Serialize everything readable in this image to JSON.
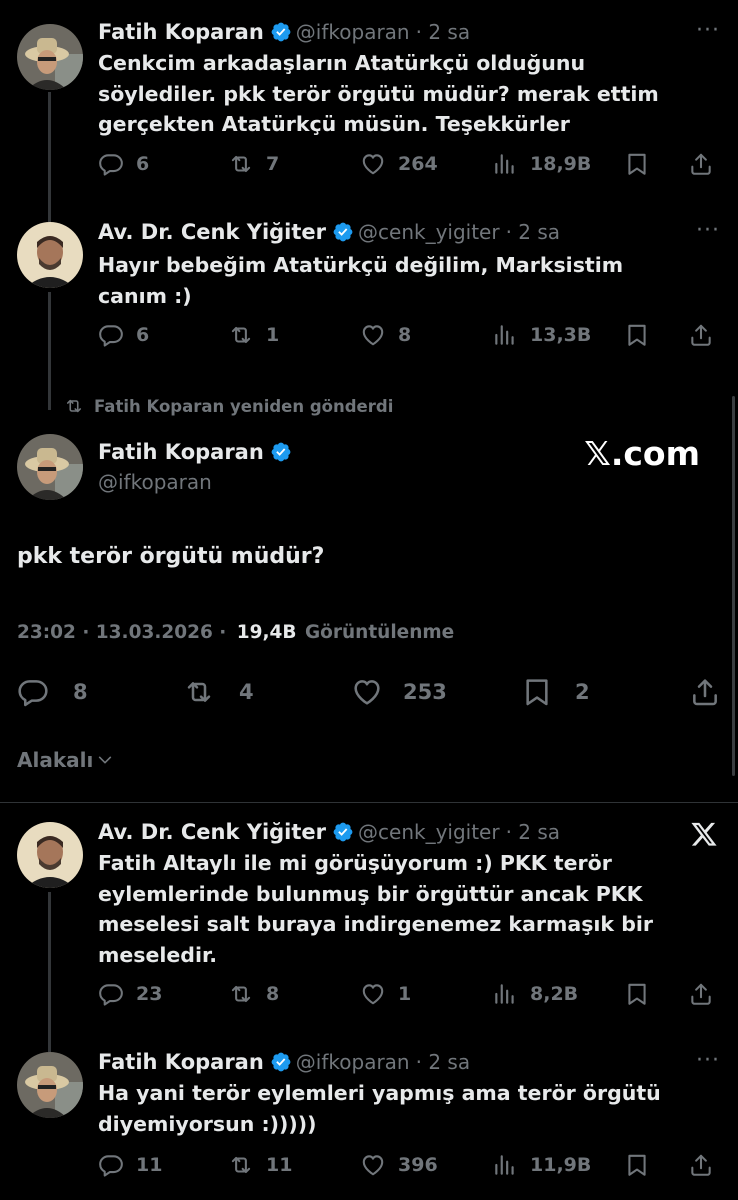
{
  "tweets": [
    {
      "author": "Fatih Koparan",
      "handle": "@ifkoparan",
      "time": "· 2 sa",
      "text_lines": [
        "Cenkcim arkadaşların Atatürkçü olduğunu",
        "söylediler. pkk terör örgütü müdür? merak ettim",
        "gerçekten Atatürkçü müsün. Teşekkürler"
      ],
      "replies": "6",
      "reposts": "7",
      "likes": "264",
      "views": "18,9B"
    },
    {
      "author": "Av. Dr. Cenk Yiğiter",
      "handle": "@cenk_yigiter",
      "time": "· 2 sa",
      "text_lines": [
        "Hayır bebeğim Atatürkçü değilim, Marksistim",
        "canım :)"
      ],
      "replies": "6",
      "reposts": "1",
      "likes": "8",
      "views": "13,3B"
    }
  ],
  "repost_banner": "Fatih Koparan yeniden gönderdi",
  "main": {
    "author": "Fatih Koparan",
    "handle": "@ifkoparan",
    "watermark": "𝕏.com",
    "text": "pkk terör örgütü müdür?",
    "timestamp": "23:02 · 13.03.2026 ·",
    "views": "19,4B",
    "views_label": "Görüntülenme",
    "replies": "8",
    "reposts": "4",
    "likes": "253",
    "bookmarks": "2"
  },
  "sort_label": "Alakalı",
  "replies": [
    {
      "author": "Av. Dr. Cenk Yiğiter",
      "handle": "@cenk_yigiter",
      "time": "· 2 sa",
      "text_lines": [
        "Fatih Altaylı ile mi görüşüyorum :) PKK terör",
        "eylemlerinde bulunmuş bir örgüttür ancak PKK",
        "meselesi salt buraya indirgenemez karmaşık bir",
        "meseledir."
      ],
      "replies": "23",
      "reposts": "8",
      "likes": "1",
      "views": "8,2B"
    },
    {
      "author": "Fatih Koparan",
      "handle": "@ifkoparan",
      "time": "· 2 sa",
      "text_lines": [
        "Ha yani terör eylemleri yapmış ama terör örgütü",
        "diyemiyorsun :)))))"
      ],
      "replies": "11",
      "reposts": "11",
      "likes": "396",
      "views": "11,9B"
    }
  ],
  "colors": {
    "background": "#000000",
    "text": "#e7e9ea",
    "muted": "#71767b",
    "verified": "#1d9bf0"
  }
}
